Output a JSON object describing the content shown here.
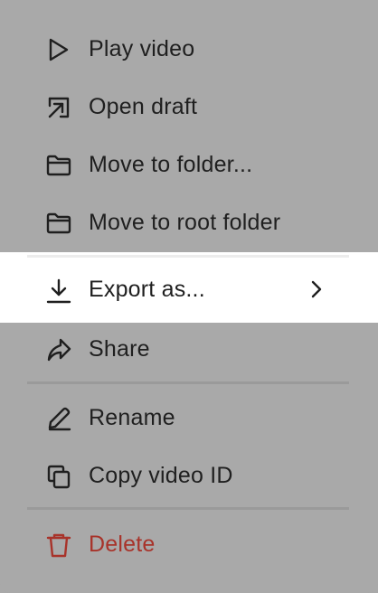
{
  "menu": {
    "items": [
      {
        "label": "Play video",
        "icon": "play-icon"
      },
      {
        "label": "Open draft",
        "icon": "open-external-icon"
      },
      {
        "label": "Move to folder...",
        "icon": "folder-icon"
      },
      {
        "label": "Move to root folder",
        "icon": "folder-icon"
      },
      {
        "label": "Export as...",
        "icon": "download-icon",
        "has_submenu": true,
        "highlighted": true
      },
      {
        "label": "Share",
        "icon": "share-icon"
      },
      {
        "label": "Rename",
        "icon": "pencil-icon"
      },
      {
        "label": "Copy video ID",
        "icon": "copy-icon"
      },
      {
        "label": "Delete",
        "icon": "trash-icon",
        "danger": true
      }
    ]
  },
  "colors": {
    "overlay": "#a9a9a9",
    "highlight": "#ffffff",
    "text": "#1f1f1f",
    "danger": "#a8332a",
    "divider": "#9a9a9a"
  }
}
